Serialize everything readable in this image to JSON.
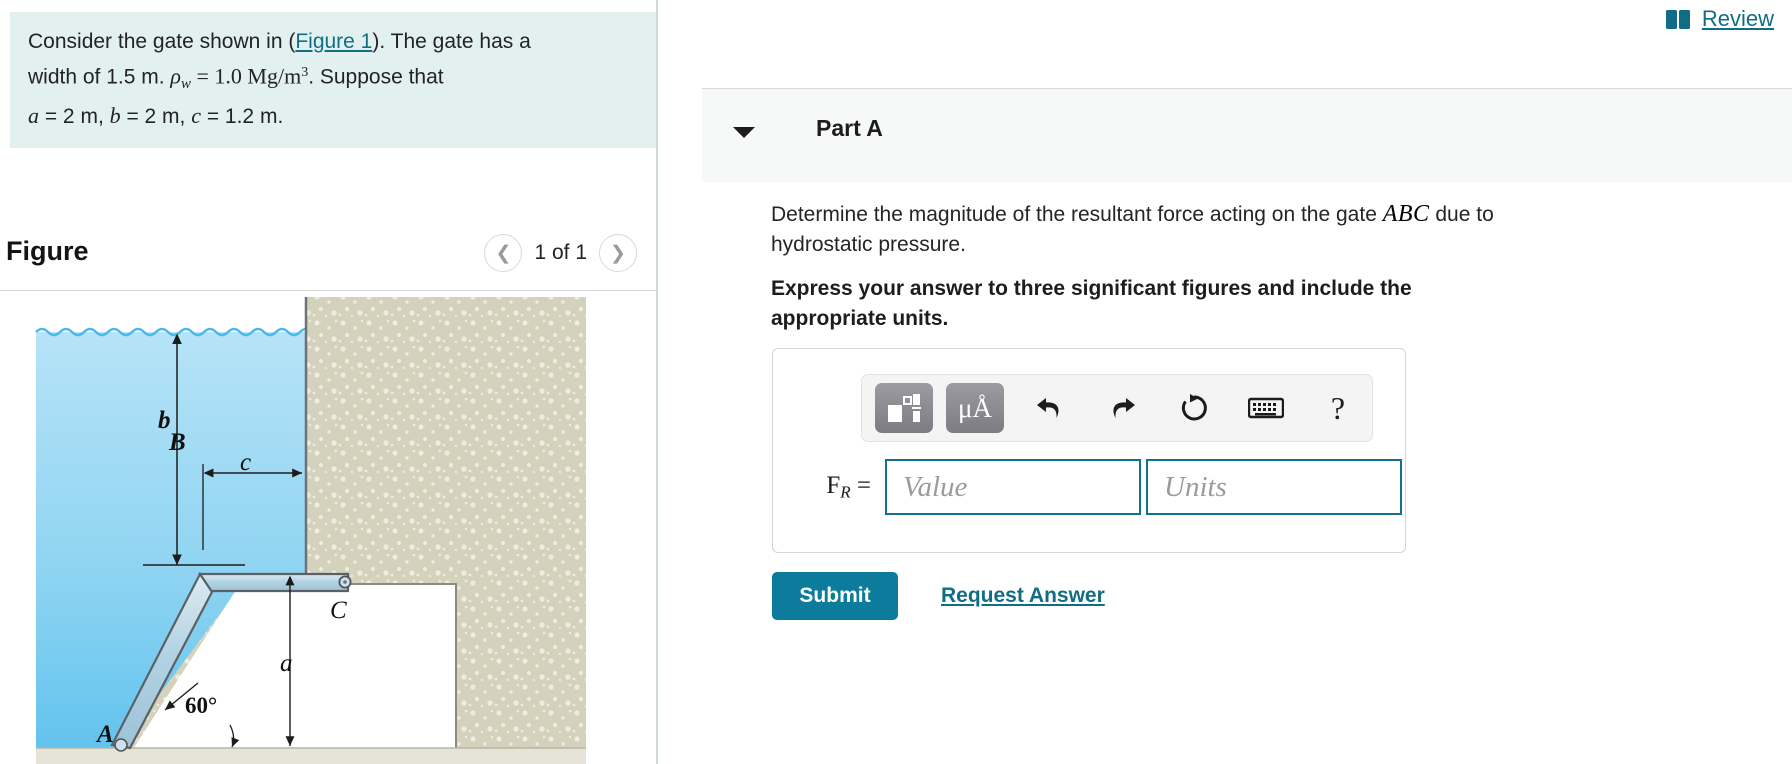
{
  "problem": {
    "line1_a": "Consider the gate shown in (",
    "figure_link": "Figure 1",
    "line1_b": "). The gate has a",
    "line2_a": "width of 1.5 m. ",
    "line2_rho": "ρ",
    "line2_rho_sub": "w",
    "line2_eq": " = 1.0 Mg/m",
    "line2_exp": "3",
    "line2_end": ". Suppose that",
    "line3_a": "a",
    "line3_b": " = 2 m, ",
    "line3_c": "b",
    "line3_d": " = 2 m, ",
    "line3_e": "c",
    "line3_f": " = 1.2 m."
  },
  "figure": {
    "title": "Figure",
    "prev_icon": "chevron-left-icon",
    "next_icon": "chevron-right-icon",
    "count_label": "1 of 1",
    "labels": {
      "b": "b",
      "c": "c",
      "a": "a",
      "A": "A",
      "B": "B",
      "C": "C",
      "angle": "60°"
    },
    "colors": {
      "water_top": "#a7dcf5",
      "water_bottom": "#63c7ef",
      "soil": "#d4d1bc",
      "gate_fill": "#b9d6e4",
      "gate_stroke": "#5a6063",
      "ground": "#e6e4d8"
    }
  },
  "review": {
    "icon": "book-icon",
    "label": "Review",
    "color": "#116d85"
  },
  "part": {
    "label": "Part A",
    "caret_icon": "chevron-down-icon",
    "question_a": "Determine the magnitude of the resultant force acting on the gate ",
    "question_math": "ABC",
    "question_b": " due to hydrostatic pressure.",
    "instruction": "Express your answer to three significant figures and include the appropriate units."
  },
  "toolbar": {
    "items": [
      {
        "name": "math-template-button",
        "icon": "math-template-icon",
        "label": ""
      },
      {
        "name": "units-button",
        "icon": "micro-angstrom-icon",
        "label": "μÅ"
      },
      {
        "name": "undo-button",
        "icon": "undo-arrow-icon",
        "label": ""
      },
      {
        "name": "redo-button",
        "icon": "redo-arrow-icon",
        "label": ""
      },
      {
        "name": "reset-button",
        "icon": "reset-circular-arrow-icon",
        "label": ""
      },
      {
        "name": "keyboard-button",
        "icon": "keyboard-icon",
        "label": ""
      },
      {
        "name": "help-button",
        "icon": "question-mark-icon",
        "label": "?"
      }
    ],
    "units_label": "μÅ",
    "help_label": "?"
  },
  "answer": {
    "force_symbol": "F",
    "force_sub": "R",
    "force_eq": " =",
    "value_placeholder": "Value",
    "units_placeholder": "Units",
    "value": "",
    "units": "",
    "accent_color": "#12718b"
  },
  "actions": {
    "submit_label": "Submit",
    "request_answer_label": "Request Answer",
    "submit_color": "#0d7b9c"
  }
}
